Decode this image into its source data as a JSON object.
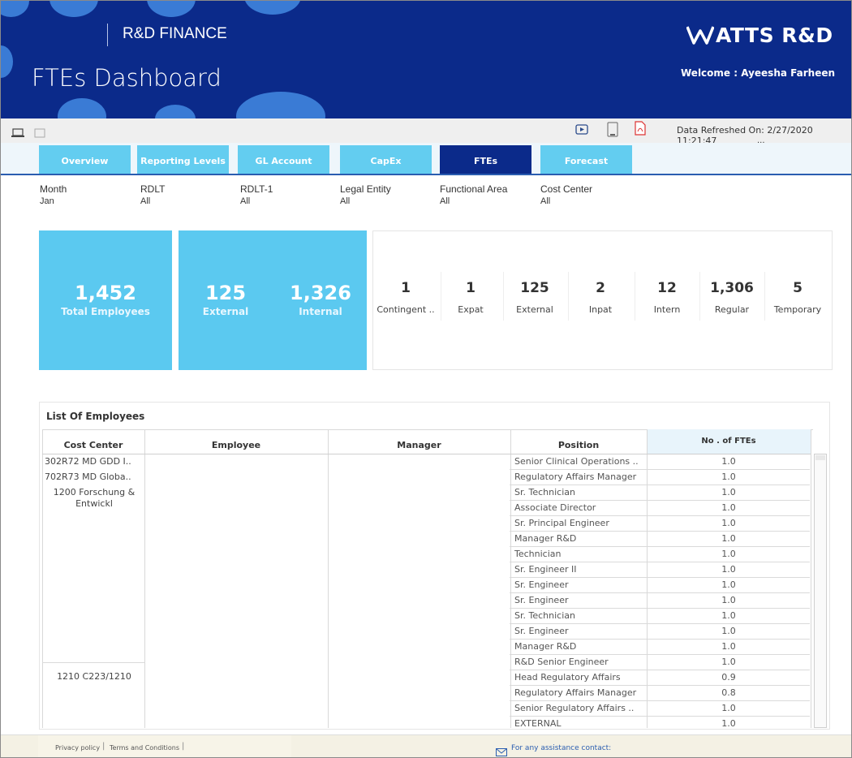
{
  "header": {
    "brand": "R&D FINANCE",
    "title": "FTEs Dashboard",
    "logo_text": "ATTS R&D",
    "welcome": "Welcome : Ayeesha Farheen"
  },
  "toolbar": {
    "refresh_text": "Data Refreshed On: 2/27/2020 11:21:47",
    "more": "..."
  },
  "tabs": [
    {
      "label": "Overview",
      "active": false
    },
    {
      "label": "Reporting Levels",
      "active": false
    },
    {
      "label": "GL Account",
      "active": false
    },
    {
      "label": "CapEx",
      "active": false
    },
    {
      "label": "FTEs",
      "active": true
    },
    {
      "label": "Forecast",
      "active": false
    }
  ],
  "filters": [
    {
      "label": "Month",
      "value": "Jan"
    },
    {
      "label": "RDLT",
      "value": "All"
    },
    {
      "label": "RDLT-1",
      "value": "All"
    },
    {
      "label": "Legal Entity",
      "value": "All"
    },
    {
      "label": "Functional Area",
      "value": "All"
    },
    {
      "label": "Cost Center",
      "value": "All"
    }
  ],
  "kpi": {
    "total_value": "1,452",
    "total_label": "Total Employees",
    "external_value": "125",
    "external_label": "External",
    "internal_value": "1,326",
    "internal_label": "Internal"
  },
  "types": [
    {
      "value": "1",
      "label": "Contingent .."
    },
    {
      "value": "1",
      "label": "Expat"
    },
    {
      "value": "125",
      "label": "External"
    },
    {
      "value": "2",
      "label": "Inpat"
    },
    {
      "value": "12",
      "label": "Intern"
    },
    {
      "value": "1,306",
      "label": "Regular"
    },
    {
      "value": "5",
      "label": "Temporary"
    }
  ],
  "employees": {
    "title": "List Of Employees",
    "columns": [
      "Cost Center",
      "Employee",
      "Manager",
      "Position",
      "No . of FTEs"
    ],
    "cost_centers": [
      "302R72 MD GDD I..",
      "702R73 MD Globa..",
      "1200 Forschung &",
      "Entwickl",
      "1210 C223/1210"
    ],
    "rows": [
      {
        "position": "Senior Clinical Operations ..",
        "ftes": "1.0"
      },
      {
        "position": "Regulatory Affairs Manager",
        "ftes": "1.0"
      },
      {
        "position": "Sr. Technician",
        "ftes": "1.0"
      },
      {
        "position": "Associate Director",
        "ftes": "1.0"
      },
      {
        "position": "Sr. Principal Engineer",
        "ftes": "1.0"
      },
      {
        "position": "Manager R&D",
        "ftes": "1.0"
      },
      {
        "position": "Technician",
        "ftes": "1.0"
      },
      {
        "position": "Sr. Engineer II",
        "ftes": "1.0"
      },
      {
        "position": "Sr. Engineer",
        "ftes": "1.0"
      },
      {
        "position": "Sr. Engineer",
        "ftes": "1.0"
      },
      {
        "position": "Sr. Technician",
        "ftes": "1.0"
      },
      {
        "position": "Sr. Engineer",
        "ftes": "1.0"
      },
      {
        "position": "Manager R&D",
        "ftes": "1.0"
      },
      {
        "position": "R&D Senior Engineer",
        "ftes": "1.0"
      },
      {
        "position": "Head Regulatory Affairs",
        "ftes": "0.9"
      },
      {
        "position": "Regulatory Affairs Manager",
        "ftes": "0.8"
      },
      {
        "position": "Senior Regulatory Affairs ..",
        "ftes": "1.0"
      },
      {
        "position": "EXTERNAL",
        "ftes": "1.0"
      }
    ]
  },
  "footer": {
    "privacy": "Privacy policy",
    "terms": "Terms and Conditions",
    "assist": "For any assistance contact:"
  },
  "colors": {
    "header_bg": "#0b2a8a",
    "tab_active": "#0b2a8a",
    "tab_inactive": "#63cdf0",
    "kpi_bg": "#5bc9f0"
  }
}
